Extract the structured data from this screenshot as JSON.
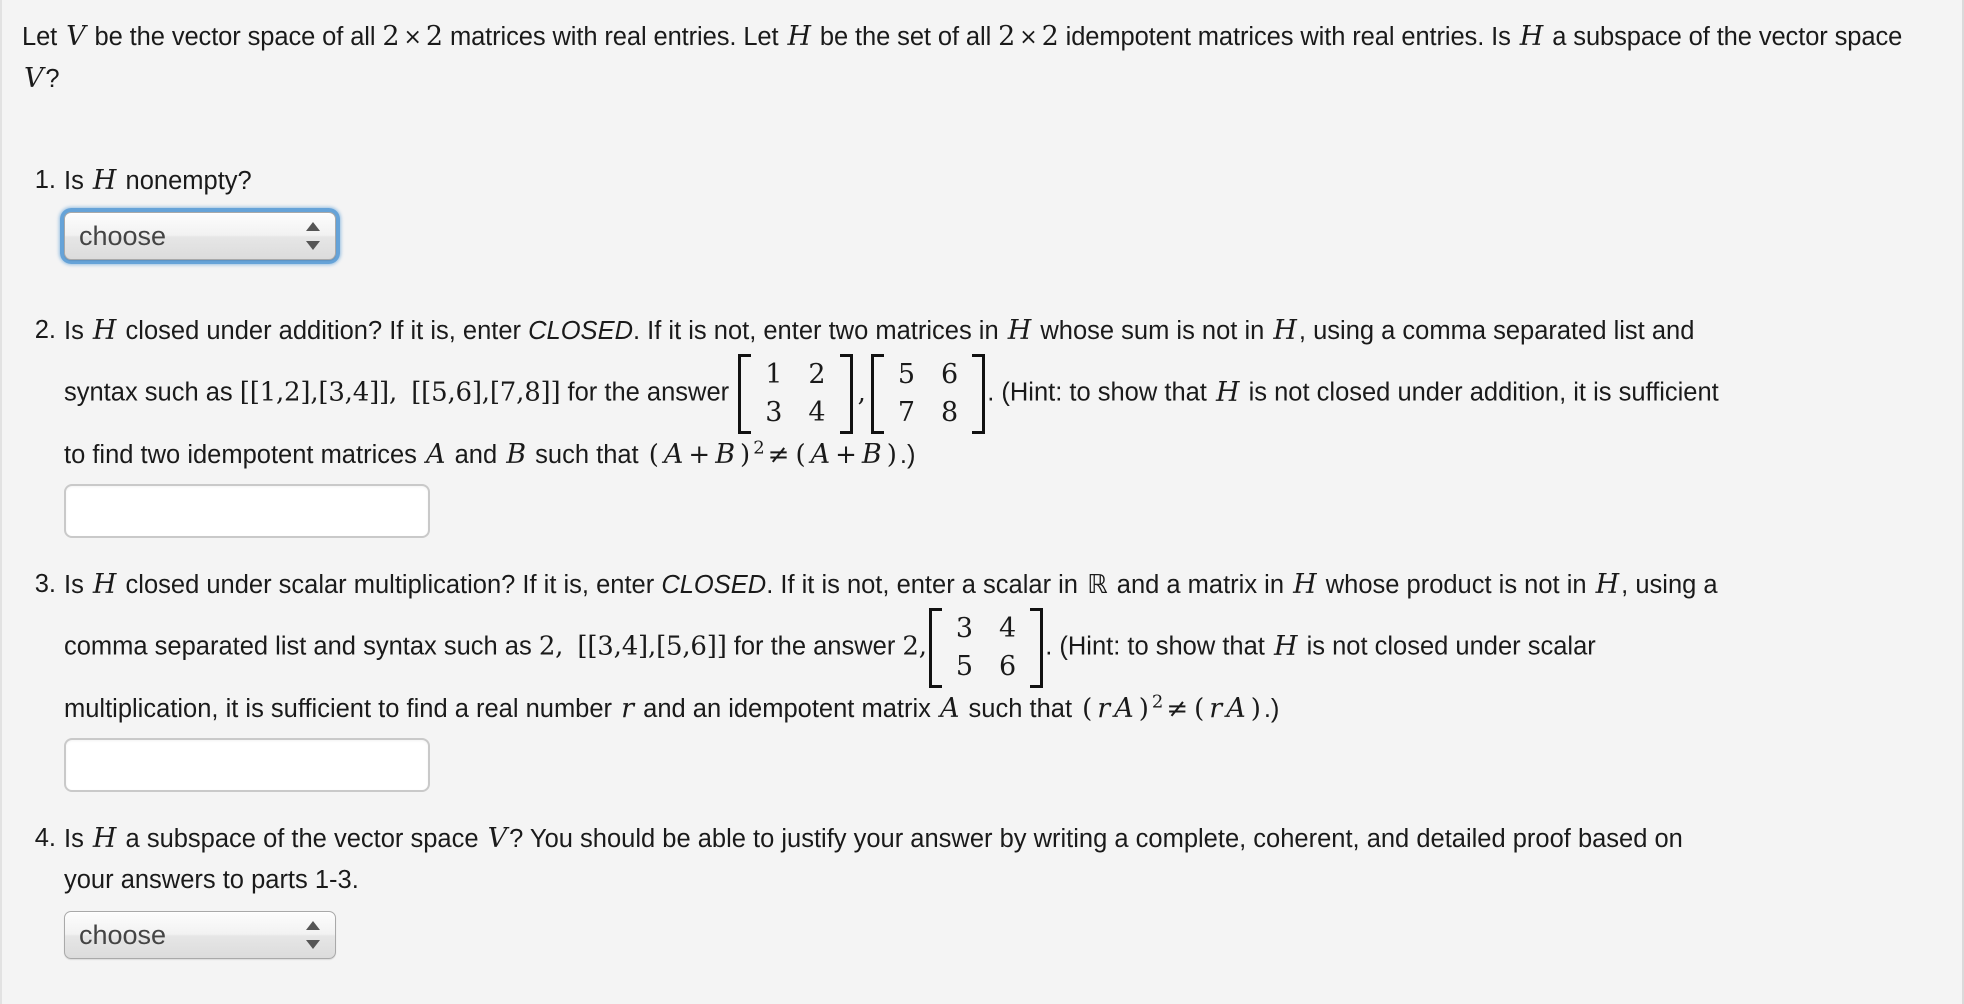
{
  "problem": {
    "intro": {
      "part1": "Let ",
      "v1": "V",
      "part2": " be the vector space of all ",
      "n1": "2",
      "times1": "×",
      "n2": "2",
      "part3": " matrices with real entries. Let ",
      "h1": "H",
      "part4": " be the set of all ",
      "n3": "2",
      "times2": "×",
      "n4": "2",
      "part5": " idempotent matrices with real entries. Is ",
      "h2": "H",
      "part6": " a subspace of the vector space ",
      "v2": "V",
      "part7": "?"
    },
    "questions": [
      {
        "number": "1.",
        "text_a": "Is ",
        "sym_a": "H",
        "text_b": " nonempty?",
        "control": "select",
        "value": "choose",
        "focused": true
      },
      {
        "number": "2.",
        "text_a": "Is ",
        "sym_a": "H",
        "text_b": " closed under addition? If it is, enter ",
        "emph_a": "CLOSED",
        "text_c": ". If it is not, enter two matrices in ",
        "sym_b": "H",
        "text_d": " whose sum is not in ",
        "sym_c": "H",
        "text_e": ", using a comma separated list and",
        "line2_a": "syntax such as ",
        "syntax_a": "[[1,2],[3,4]],",
        "syntax_b": "[[5,6],[7,8]]",
        "line2_b": " for the answer ",
        "matrix_a": [
          [
            "1",
            "2"
          ],
          [
            "3",
            "4"
          ]
        ],
        "matrix_comma": ",",
        "matrix_b": [
          [
            "5",
            "6"
          ],
          [
            "7",
            "8"
          ]
        ],
        "line2_c": ". (Hint: to show that ",
        "sym_d": "H",
        "line2_d": " is not closed under addition, it is sufficient",
        "line3_a": "to find two idempotent matrices ",
        "sym_e": "A",
        "line3_b": " and ",
        "sym_f": "B",
        "line3_c": " such that ",
        "expr_open": "(",
        "expr_A": "A",
        "expr_plus": "+",
        "expr_B": "B",
        "expr_close": ")",
        "expr_sup": "2",
        "expr_neq": "≠",
        "expr2_open": "(",
        "expr2_A": "A",
        "expr2_plus": "+",
        "expr2_B": "B",
        "expr2_close": ")",
        "line3_d": ".)",
        "control": "input",
        "value": "",
        "placeholder": ""
      },
      {
        "number": "3.",
        "text_a": "Is ",
        "sym_a": "H",
        "text_b": " closed under scalar multiplication? If it is, enter ",
        "emph_a": "CLOSED",
        "text_c": ". If it is not, enter a scalar in ",
        "sym_R": "ℝ",
        "text_d": " and a matrix in ",
        "sym_b": "H",
        "text_e": " whose product is not in ",
        "sym_c": "H",
        "text_f": ", using a",
        "line2_a": "comma separated list and syntax such as ",
        "syntax_a": "2,",
        "syntax_b": "[[3,4],[5,6]]",
        "line2_b": " for the answer ",
        "answer_scalar": "2,",
        "matrix_a": [
          [
            "3",
            "4"
          ],
          [
            "5",
            "6"
          ]
        ],
        "line2_c": ". (Hint: to show that ",
        "sym_d": "H",
        "line2_d": " is not closed under scalar",
        "line3_a": "multiplication, it is sufficient to find a real number ",
        "sym_r": "r",
        "line3_b": " and an idempotent matrix ",
        "sym_e": "A",
        "line3_c": " such that ",
        "expr_open": "(",
        "expr_r": "r",
        "expr_A": "A",
        "expr_close": ")",
        "expr_sup": "2",
        "expr_neq": "≠",
        "expr2_open": "(",
        "expr2_r": "r",
        "expr2_A": "A",
        "expr2_close": ")",
        "line3_d": ".)",
        "control": "input",
        "value": "",
        "placeholder": ""
      },
      {
        "number": "4.",
        "text_a": "Is ",
        "sym_a": "H",
        "text_b": " a subspace of the vector space ",
        "sym_V": "V",
        "text_c": "? You should be able to justify your answer by writing a complete, coherent, and detailed proof based on",
        "line2": "your answers to parts 1-3.",
        "control": "select",
        "value": "choose",
        "focused": false
      }
    ],
    "select_options": [
      "choose"
    ]
  },
  "colors": {
    "background": "#f4f4f4",
    "text": "#1a1a1a",
    "focus_ring": "#5e9ed6",
    "input_border": "#c9c9c9",
    "select_border": "#a9a9a9"
  }
}
